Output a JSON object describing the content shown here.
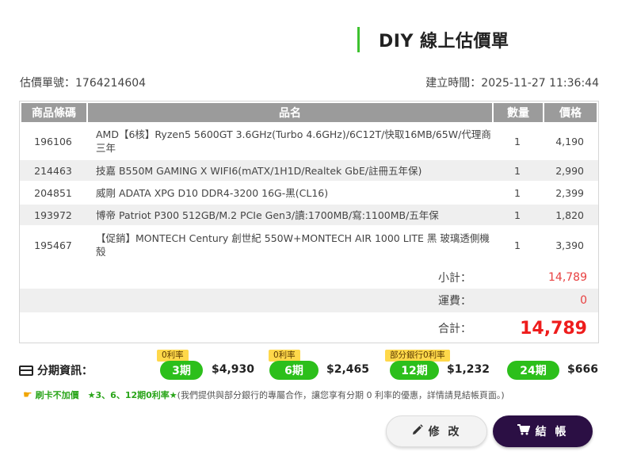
{
  "header": {
    "title": "DIY 線上估價單"
  },
  "meta": {
    "quote_no": "估價單號：1764214604",
    "created": "建立時間：2025-11-27 11:36:44"
  },
  "table": {
    "columns": [
      "商品條碼",
      "品名",
      "數量",
      "價格"
    ],
    "rows": [
      {
        "code": "196106",
        "name": "AMD【6核】Ryzen5 5600GT 3.6GHz(Turbo 4.6GHz)/6C12T/快取16MB/65W/代理商三年",
        "qty": "1",
        "price": "4,190"
      },
      {
        "code": "214463",
        "name": "技嘉 B550M GAMING X WIFI6(mATX/1H1D/Realtek GbE/註冊五年保)",
        "qty": "1",
        "price": "2,990"
      },
      {
        "code": "204851",
        "name": "威剛 ADATA XPG D10 DDR4-3200 16G-黑(CL16)",
        "qty": "1",
        "price": "2,399"
      },
      {
        "code": "193972",
        "name": "博帝 Patriot P300 512GB/M.2 PCIe Gen3/讀:1700MB/寫:1100MB/五年保",
        "qty": "1",
        "price": "1,820"
      },
      {
        "code": "195467",
        "name": "【促銷】MONTECH Century 創世紀 550W+MONTECH AIR 1000 LITE 黑 玻璃透側機殼",
        "qty": "1",
        "price": "3,390"
      }
    ],
    "subtotal_label": "小計：",
    "subtotal": "14,789",
    "shipping_label": "運費：",
    "shipping": "0",
    "total_label": "合計：",
    "total": "14,789"
  },
  "installment": {
    "label": "分期資訊：",
    "plans": [
      {
        "tag": "0利率",
        "period": "3期",
        "amount": "$4,930"
      },
      {
        "tag": "0利率",
        "period": "6期",
        "amount": "$2,465"
      },
      {
        "tag": "部分銀行0利率",
        "period": "12期",
        "amount": "$1,232"
      },
      {
        "tag": "",
        "period": "24期",
        "amount": "$666"
      }
    ]
  },
  "note": {
    "highlight": "刷卡不加價　★3、6、12期0利率★",
    "text": "(我們提供與部分銀行的專屬合作，讓您享有分期 0 利率的優惠，詳情請見結帳頁面。)"
  },
  "actions": {
    "edit_label": "修 改",
    "checkout_label": "結 帳"
  },
  "icons": {
    "card": "credit-card-icon",
    "hand": "pointing-hand-icon",
    "pencil": "pencil-icon",
    "cart": "cart-icon"
  },
  "colors": {
    "accent_green": "#2cbf1b",
    "tag_yellow": "#ffd84a",
    "price_red": "#ee1c1c",
    "checkout_purple": "#2b0f44"
  }
}
